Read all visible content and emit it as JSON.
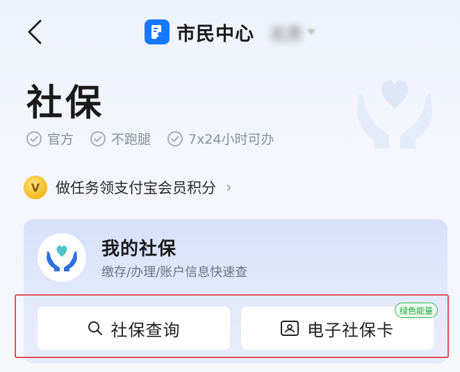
{
  "header": {
    "title": "市民中心",
    "city": "北京",
    "icons": {
      "back": "chevron-left-icon",
      "app": "document-user-icon",
      "city_caret": "caret-down-icon"
    }
  },
  "page": {
    "title": "社保",
    "tags": [
      "官方",
      "不跑腿",
      "7x24小时可办"
    ],
    "hero_icon": "heart-hands-icon"
  },
  "promo": {
    "text": "做任务领支付宝会员积分",
    "arrow": "›",
    "icon": "v-coin-icon"
  },
  "card": {
    "title": "我的社保",
    "subtitle": "缴存/办理/账户信息快速查",
    "logo_icon": "heart-hands-icon"
  },
  "actions": {
    "query": {
      "label": "社保查询",
      "icon": "search-icon"
    },
    "ecard": {
      "label": "电子社保卡",
      "icon": "id-card-icon",
      "badge": "绿色能量"
    }
  },
  "colors": {
    "brand_blue": "#1677ff",
    "highlight_red": "#e0505a",
    "badge_green": "#2db84d"
  }
}
